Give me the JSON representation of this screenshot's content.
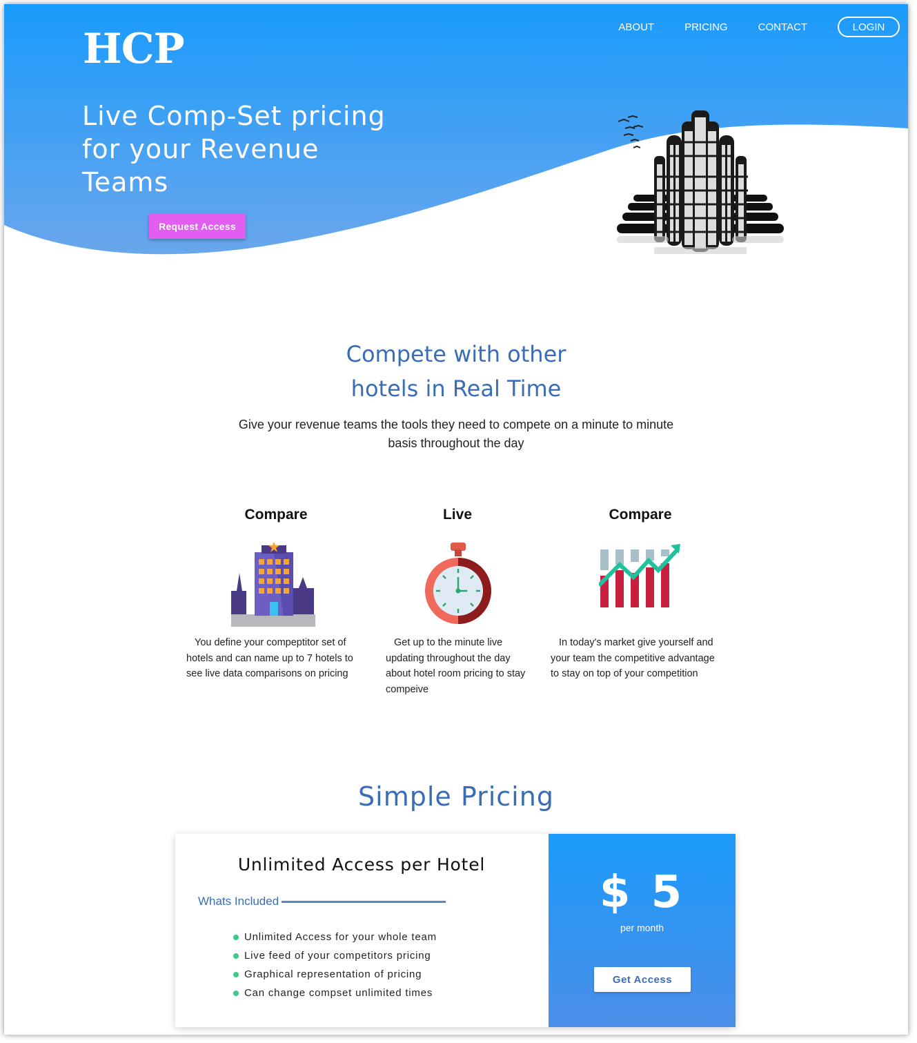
{
  "brand": {
    "logo": "HCP"
  },
  "nav": {
    "items": [
      {
        "label": "ABOUT"
      },
      {
        "label": "PRICING"
      },
      {
        "label": "CONTACT"
      }
    ],
    "login_label": "LOGIN"
  },
  "hero": {
    "title": "Live Comp-Set pricing for your Revenue Teams",
    "cta_label": "Request Access"
  },
  "compete": {
    "title_line1": "Compete with other",
    "title_line2": "hotels in Real Time",
    "subtitle": "Give your revenue teams the tools they need to compete on a minute to minute basis throughout the day"
  },
  "features": [
    {
      "title": "Compare",
      "icon": "hotel-building-icon",
      "text": "You define your compeptitor set of hotels and can name up to 7 hotels to see live data comparisons on pricing"
    },
    {
      "title": "Live",
      "icon": "stopwatch-icon",
      "text": "Get up to the minute live updating throughout the day about hotel room pricing to stay compeive"
    },
    {
      "title": "Compare",
      "icon": "trending-chart-icon",
      "text": "In today's market give yourself and your team the competitive advantage to stay on top of your competition"
    }
  ],
  "pricing": {
    "title": "Simple Pricing",
    "plan_title": "Unlimited Access per Hotel",
    "included_label": "Whats Included",
    "included_items": [
      "Unlimited Access for your whole team",
      "Live feed of your competitors pricing",
      "Graphical representation of pricing",
      "Can change compset unlimited times"
    ],
    "price": "$ 5",
    "period": "per month",
    "cta_label": "Get Access"
  },
  "colors": {
    "hero_top": "#1a9bfc",
    "hero_bottom": "#5aa0ea",
    "heading_blue": "#3a6db5",
    "cta_pink": "#e15ef0",
    "bullet_green": "#3cc98a"
  }
}
